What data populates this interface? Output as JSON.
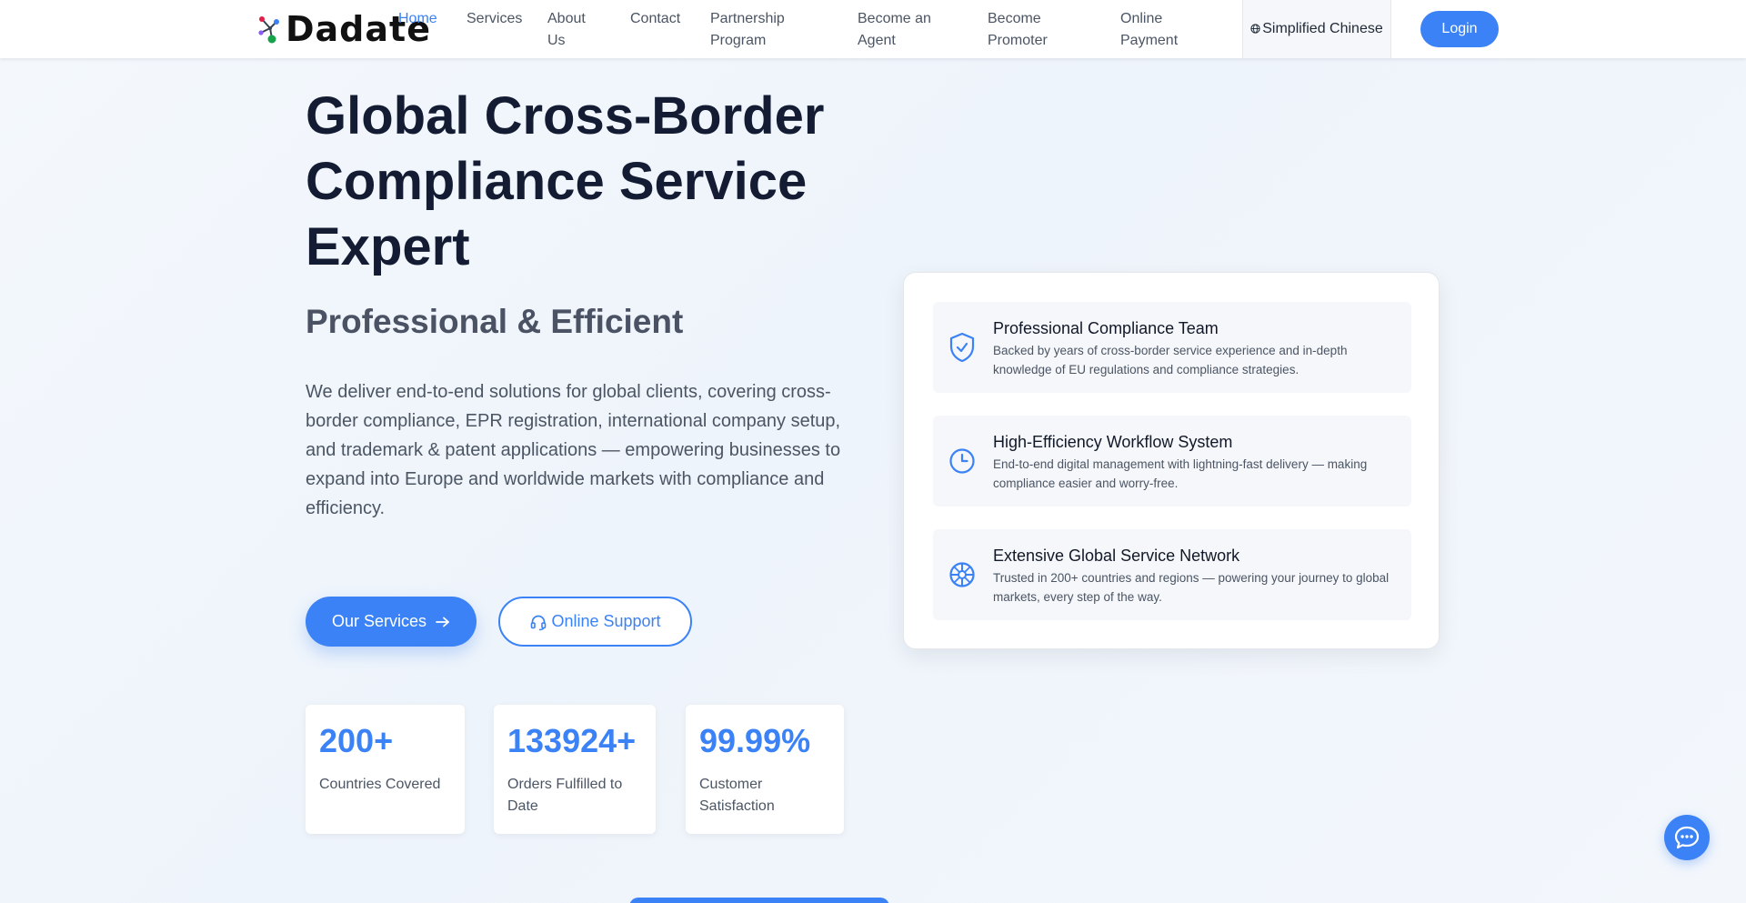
{
  "brand": {
    "name": "Dadate"
  },
  "nav": {
    "items": [
      {
        "label": "Home",
        "active": true
      },
      {
        "label": "Services",
        "active": false
      },
      {
        "label": "About Us",
        "active": false
      },
      {
        "label": "Contact",
        "active": false
      },
      {
        "label": "Partnership Program",
        "active": false
      },
      {
        "label": "Become an Agent",
        "active": false
      },
      {
        "label": "Become Promoter",
        "active": false
      },
      {
        "label": "Online Payment",
        "active": false
      }
    ],
    "language": {
      "icon": "globe-icon",
      "label": "Simplified Chinese"
    },
    "login_label": "Login"
  },
  "hero": {
    "title": "Global Cross-Border Compliance Service Expert",
    "subtitle": "Professional & Efficient",
    "description": "We deliver end-to-end solutions for global clients, covering cross-border compliance, EPR registration, international company setup, and trademark & patent applications — empowering businesses to expand into Europe and worldwide markets with compliance and efficiency.",
    "primary_button": {
      "label": "Our Services",
      "icon": "arrow-right-icon"
    },
    "secondary_button": {
      "label": "Online Support",
      "icon": "headset-icon"
    }
  },
  "stats": [
    {
      "value": "200+",
      "label": "Countries Covered"
    },
    {
      "value": "133924+",
      "label": "Orders Fulfilled to Date"
    },
    {
      "value": "99.99%",
      "label": "Customer Satisfaction"
    }
  ],
  "features": [
    {
      "icon": "shield-check-icon",
      "title": "Professional Compliance Team",
      "description": "Backed by years of cross-border service experience and in-depth knowledge of EU regulations and compliance strategies."
    },
    {
      "icon": "clock-icon",
      "title": "High-Efficiency Workflow System",
      "description": "End-to-end digital management with lightning-fast delivery — making compliance easier and worry-free."
    },
    {
      "icon": "globe-network-icon",
      "title": "Extensive Global Service Network",
      "description": "Trusted in 200+ countries and regions — powering your journey to global markets, every step of the way."
    }
  ],
  "chat": {
    "icon": "chat-bubble-icon"
  },
  "colors": {
    "accent": "#3b82f6",
    "heading": "#141c33",
    "body_text": "#4b5563",
    "background": "#eef4fb"
  }
}
